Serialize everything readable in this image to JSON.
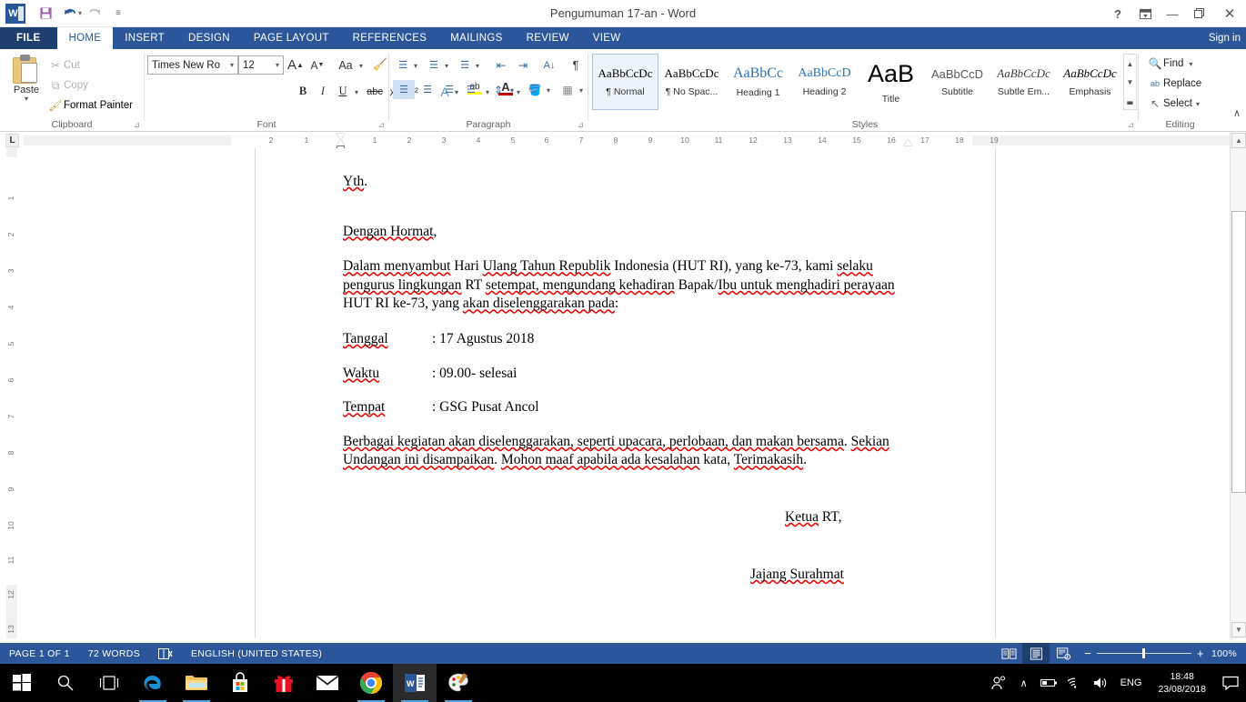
{
  "titlebar": {
    "doc_title": "Pengumuman 17-an - Word",
    "logo_text": "W",
    "quick_access": [
      {
        "name": "save",
        "glyph": "█"
      },
      {
        "name": "undo",
        "glyph": "↶"
      },
      {
        "name": "redo",
        "glyph": "↻"
      },
      {
        "name": "customize",
        "glyph": "≡"
      }
    ],
    "help": "?",
    "ribbon_display": "⤓",
    "minimize": "—",
    "restore": "❐",
    "close": "✕",
    "sign_in": "Sign in"
  },
  "tabs": {
    "file": "FILE",
    "items": [
      "HOME",
      "INSERT",
      "DESIGN",
      "PAGE LAYOUT",
      "REFERENCES",
      "MAILINGS",
      "REVIEW",
      "VIEW"
    ],
    "active": "HOME"
  },
  "ribbon": {
    "clipboard": {
      "label": "Clipboard",
      "paste": "Paste",
      "cut": "Cut",
      "copy": "Copy",
      "format_painter": "Format Painter"
    },
    "font": {
      "label": "Font",
      "font_name": "Times New Ro",
      "font_size": "12",
      "grow": "A",
      "shrink": "A",
      "change_case": "Aa",
      "clear_formatting": "✐",
      "bold": "B",
      "italic": "I",
      "underline": "U",
      "strikethrough": "abc",
      "subscript": "x₂",
      "superscript": "x²",
      "text_effects": "A",
      "highlight": "ab",
      "font_color": "A"
    },
    "paragraph": {
      "label": "Paragraph",
      "bullets": "☰",
      "numbering": "☰",
      "multilevel": "☰",
      "decrease_indent": "⇤",
      "increase_indent": "⇥",
      "sort": "A↓",
      "show_marks": "¶",
      "align_left": "☰",
      "align_center": "☰",
      "align_right": "☰",
      "justify": "☰",
      "line_spacing": "↕",
      "shading": "▤",
      "borders": "▦"
    },
    "styles": {
      "label": "Styles",
      "items": [
        {
          "preview": "AaBbCcDc",
          "name": "¶ Normal",
          "selected": true,
          "color": "#000000",
          "size": "13px",
          "style": "normal"
        },
        {
          "preview": "AaBbCcDc",
          "name": "¶ No Spac...",
          "selected": false,
          "color": "#000000",
          "size": "13px",
          "style": "normal"
        },
        {
          "preview": "AaBbCс",
          "name": "Heading 1",
          "selected": false,
          "color": "#2e74b5",
          "size": "16px",
          "style": "normal"
        },
        {
          "preview": "AaBbCcD",
          "name": "Heading 2",
          "selected": false,
          "color": "#2e74b5",
          "size": "14px",
          "style": "normal"
        },
        {
          "preview": "AaB",
          "name": "Title",
          "selected": false,
          "color": "#000000",
          "size": "26px",
          "style": "normal"
        },
        {
          "preview": "AaBbCcD",
          "name": "Subtitle",
          "selected": false,
          "color": "#5a5a5a",
          "size": "13px",
          "style": "normal"
        },
        {
          "preview": "AaBbCcDc",
          "name": "Subtle Em...",
          "selected": false,
          "color": "#404040",
          "size": "13px",
          "style": "italic"
        },
        {
          "preview": "AaBbCcDc",
          "name": "Emphasis",
          "selected": false,
          "color": "#000000",
          "size": "13px",
          "style": "italic"
        }
      ],
      "scroll_up": "▲",
      "scroll_down": "▼",
      "more": "▃"
    },
    "editing": {
      "label": "Editing",
      "find": "Find",
      "replace": "Replace",
      "select": "Select"
    },
    "collapse": "∧"
  },
  "ruler": {
    "horizontal_ticks": [
      "2",
      "1",
      "1",
      "2",
      "3",
      "4",
      "5",
      "6",
      "7",
      "8",
      "9",
      "10",
      "11",
      "12",
      "13",
      "14",
      "15",
      "16",
      "17",
      "18",
      "19"
    ],
    "vertical_ticks": [
      "1",
      "2",
      "3",
      "4",
      "5",
      "6",
      "7",
      "8",
      "9",
      "10",
      "11",
      "12",
      "13"
    ],
    "tab_selector": "L"
  },
  "document": {
    "paragraphs": [
      {
        "id": "salutation",
        "segments": [
          {
            "t": "Yth",
            "sq": true
          },
          {
            "t": ".",
            "sq": false
          }
        ],
        "gap": true,
        "indent": 0
      },
      {
        "id": "greeting",
        "segments": [
          {
            "t": "Dengan Hormat",
            "sq": true
          },
          {
            "t": ",",
            "sq": false
          }
        ],
        "gap": false,
        "indent": 0
      },
      {
        "id": "body-1",
        "segments": [
          {
            "t": "Dalam menyambut",
            "sq": true
          },
          {
            "t": " Hari ",
            "sq": false
          },
          {
            "t": "Ulang Tahun Republik",
            "sq": true
          },
          {
            "t": " Indonesia (HUT RI), yang ke-73, kami ",
            "sq": false
          },
          {
            "t": "selaku pengurus lingkungan",
            "sq": true
          },
          {
            "t": " RT ",
            "sq": false
          },
          {
            "t": "setempat, mengundang kehadiran",
            "sq": true
          },
          {
            "t": " Bapak/",
            "sq": false
          },
          {
            "t": "Ibu untuk menghadiri perayaan",
            "sq": true
          },
          {
            "t": " HUT RI ke-73, yang ",
            "sq": false
          },
          {
            "t": "akan diselenggarakan pada",
            "sq": true
          },
          {
            "t": ":",
            "sq": false
          }
        ],
        "gap": false,
        "indent": 0
      },
      {
        "id": "row-tanggal",
        "label": "Tanggal",
        "label_sq": true,
        "value": ": 17 Agustus 2018",
        "value_sq_word": "Agustus",
        "gap": false
      },
      {
        "id": "row-waktu",
        "label": "Waktu",
        "label_sq": true,
        "value": ":  09.00- selesai",
        "value_sq_word": "selesai",
        "gap": false
      },
      {
        "id": "row-tempat",
        "label": "Tempat",
        "label_sq": true,
        "value": ": GSG Pusat Ancol",
        "value_sq_word": "Pusat Ancol",
        "gap": false
      },
      {
        "id": "body-2",
        "segments": [
          {
            "t": "Berbagai kegiatan akan diselenggarakan, seperti upacara, perlobaan, dan makan bersama",
            "sq": true
          },
          {
            "t": ". ",
            "sq": false
          },
          {
            "t": "Sekian Undangan ini disampaikan",
            "sq": true
          },
          {
            "t": ". ",
            "sq": false
          },
          {
            "t": "Mohon maaf apabila ada kesalahan",
            "sq": true
          },
          {
            "t": " kata, ",
            "sq": false
          },
          {
            "t": "Terimakasih",
            "sq": true
          },
          {
            "t": ".",
            "sq": false
          }
        ],
        "gap": false,
        "indent": 0
      }
    ],
    "signature_title_sq": "Ketua",
    "signature_title_rest": " RT,",
    "signature_name": "Jajang Surahmat"
  },
  "statusbar": {
    "page": "PAGE 1 OF 1",
    "words": "72 WORDS",
    "proofing_icon": "☷",
    "language": "ENGLISH (UNITED STATES)",
    "views": [
      {
        "name": "read-mode",
        "glyph": "▤",
        "active": false
      },
      {
        "name": "print-layout",
        "glyph": "▦",
        "active": true
      },
      {
        "name": "web-layout",
        "glyph": "▧",
        "active": false
      }
    ],
    "zoom_out": "−",
    "zoom_in": "+",
    "zoom_level": "100%"
  },
  "taskbar": {
    "items": [
      {
        "name": "start-button",
        "kind": "start",
        "running": false,
        "active": false
      },
      {
        "name": "search-icon",
        "kind": "search",
        "running": false,
        "active": false
      },
      {
        "name": "task-view-icon",
        "kind": "taskview",
        "running": false,
        "active": false
      },
      {
        "name": "edge-icon",
        "kind": "edge",
        "running": true,
        "active": false
      },
      {
        "name": "file-explorer-icon",
        "kind": "explorer",
        "running": true,
        "active": false
      },
      {
        "name": "microsoft-store-icon",
        "kind": "store",
        "running": false,
        "active": false
      },
      {
        "name": "gift-icon",
        "kind": "gift",
        "running": false,
        "active": false
      },
      {
        "name": "mail-icon",
        "kind": "mail",
        "running": false,
        "active": false
      },
      {
        "name": "chrome-icon",
        "kind": "chrome",
        "running": true,
        "active": false
      },
      {
        "name": "word-icon",
        "kind": "word",
        "running": false,
        "active": true
      },
      {
        "name": "paint-icon",
        "kind": "paint",
        "running": true,
        "active": false
      }
    ],
    "tray": {
      "people_icon": "⛹",
      "show_hidden": "∧",
      "battery_icon": "▢",
      "wifi_icon": "◠",
      "volume_icon": "🔊",
      "language": "ENG",
      "time": "18:48",
      "date": "23/08/2018",
      "action_center": "⬜"
    }
  },
  "colors": {
    "word_blue": "#2b579a",
    "word_blue_dark": "#1e3f70",
    "spellcheck_red": "#e00000",
    "heading_blue": "#2e74b5"
  }
}
